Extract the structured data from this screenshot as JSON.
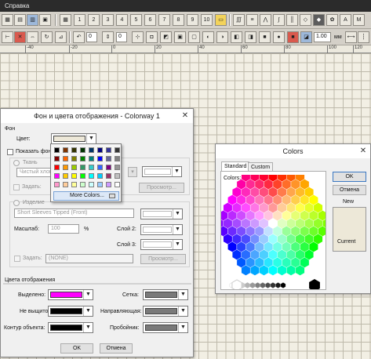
{
  "menu": {
    "label": "Справка"
  },
  "toolbar": {
    "numbers": [
      "1",
      "2",
      "3",
      "4",
      "5",
      "6",
      "7",
      "8",
      "9",
      "10"
    ],
    "value_a": "0",
    "value_b": "0",
    "zoom": "1.00",
    "unit": "мм"
  },
  "ruler": {
    "ticks": [
      "-40",
      "-20",
      "0",
      "20",
      "40",
      "60",
      "80",
      "100",
      "120"
    ]
  },
  "colorway": {
    "title": "Фон и цвета отображения - Colorway 1",
    "close": "✕",
    "section_bg": "Фон",
    "color_label": "Цвет:",
    "color_value": "#ede8d8",
    "show_bg_label": "Показать фон",
    "fabric_label": "Ткань",
    "fabric_value": "Чистый хлоп",
    "set_label": "Задать:",
    "preview_label": "Просмотр...",
    "product_label": "Изделие",
    "product_value": "Short Sleeves Tipped (Front)",
    "scale_label": "Масштаб:",
    "scale_value": "100",
    "percent": "%",
    "layer2_label": "Слой 2:",
    "layer3_label": "Слой 3:",
    "set2_label": "Задать:",
    "none_value": "(NONE)",
    "preview2_label": "Просмотр...",
    "display_colors": "Цвета отображения",
    "selected_label": "Выделено:",
    "unselected_label": "Не выщито",
    "outline_label": "Контур объекта:",
    "grid_label": "Сетка:",
    "guide_label": "Направляющая:",
    "trial_label": "Пробойник:",
    "selected_color": "#ff00ff",
    "unselected_color": "#000000",
    "outline_color": "#000000",
    "grid_color": "#7a7a7a",
    "guide_color": "#7a7a7a",
    "trial_color": "#7a7a7a",
    "ok": "OK",
    "cancel": "Отмена"
  },
  "popup": {
    "swatches": [
      "#000000",
      "#7f3300",
      "#333300",
      "#003300",
      "#003366",
      "#000080",
      "#333399",
      "#333333",
      "#800000",
      "#ff6600",
      "#808000",
      "#008000",
      "#008080",
      "#0000ff",
      "#666699",
      "#808080",
      "#ff0000",
      "#ff9900",
      "#99cc00",
      "#339966",
      "#33cccc",
      "#3366ff",
      "#800080",
      "#969696",
      "#ff00ff",
      "#ffcc00",
      "#ffff00",
      "#00ff00",
      "#00ffff",
      "#00ccff",
      "#993366",
      "#c0c0c0",
      "#ff99cc",
      "#ffcc99",
      "#ffff99",
      "#ccffcc",
      "#ccffff",
      "#99ccff",
      "#cc99ff",
      "#ffffff"
    ],
    "more_colors": "More Colors..."
  },
  "colors_dialog": {
    "title": "Colors",
    "close": "✕",
    "tab_standard": "Standard",
    "tab_custom": "Custom",
    "colors_label": "Colors:",
    "ok": "OK",
    "cancel": "Отмена",
    "new_label": "New",
    "current_label": "Current",
    "new_color": "#ede8d8",
    "current_color": "#ede8d8"
  }
}
